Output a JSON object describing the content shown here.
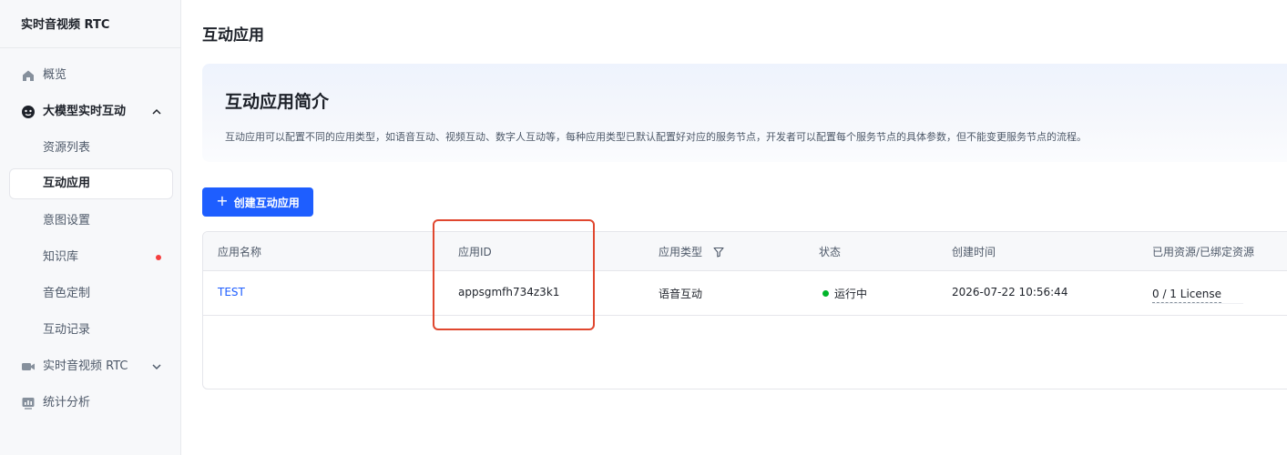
{
  "sidebar": {
    "brand": "实时音视频 RTC",
    "items": [
      {
        "label": "概览",
        "icon": "home-icon"
      },
      {
        "label": "大模型实时互动",
        "icon": "ai-face-icon"
      },
      {
        "label": "资源列表"
      },
      {
        "label": "互动应用"
      },
      {
        "label": "意图设置"
      },
      {
        "label": "知识库"
      },
      {
        "label": "音色定制"
      },
      {
        "label": "互动记录"
      },
      {
        "label": "实时音视频 RTC",
        "icon": "video-icon"
      },
      {
        "label": "统计分析",
        "icon": "chart-icon"
      }
    ]
  },
  "page": {
    "title": "互动应用"
  },
  "intro": {
    "title": "互动应用简介",
    "desc": "互动应用可以配置不同的应用类型，如语音互动、视频互动、数字人互动等，每种应用类型已默认配置好对应的服务节点，开发者可以配置每个服务节点的具体参数，但不能变更服务节点的流程。"
  },
  "toolbar": {
    "create_label": "创建互动应用",
    "create_icon": "+"
  },
  "table": {
    "columns": [
      "应用名称",
      "应用ID",
      "应用类型",
      "状态",
      "创建时间",
      "已用资源/已绑定资源"
    ],
    "rows": [
      {
        "name": "TEST",
        "app_id": "appsgmfh734z3k1",
        "type": "语音互动",
        "status": "运行中",
        "created": "2026-07-22 10:56:44",
        "resource": "0 / 1  License"
      }
    ]
  },
  "colors": {
    "accent": "#1e5eff",
    "status_running": "#00b42a",
    "highlight": "#e0472f",
    "notice_dot": "#f53f3f"
  }
}
